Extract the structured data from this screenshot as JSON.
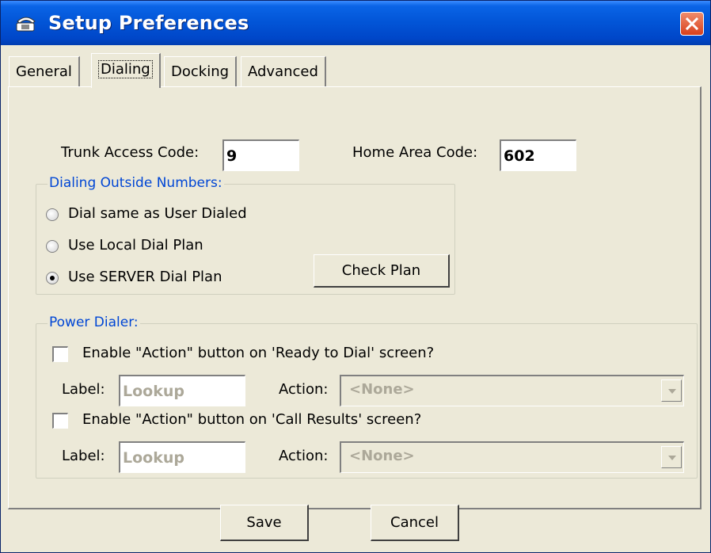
{
  "window": {
    "title": "Setup Preferences"
  },
  "tabs": [
    {
      "label": "General"
    },
    {
      "label": "Dialing",
      "selected": true
    },
    {
      "label": "Docking"
    },
    {
      "label": "Advanced"
    }
  ],
  "dialing": {
    "trunk_access_code": {
      "label": "Trunk Access Code:",
      "value": "9"
    },
    "home_area_code": {
      "label": "Home Area Code:",
      "value": "602"
    },
    "outside_numbers": {
      "title": "Dialing Outside Numbers:",
      "options": [
        {
          "label": "Dial same as User Dialed",
          "selected": false
        },
        {
          "label": "Use Local Dial Plan",
          "selected": false
        },
        {
          "label": "Use SERVER Dial Plan",
          "selected": true
        }
      ],
      "check_plan_label": "Check Plan"
    },
    "power_dialer": {
      "title": "Power Dialer:",
      "ready_to_dial": {
        "checkbox_label": "Enable \"Action\" button on 'Ready to Dial' screen?",
        "checked": false,
        "label_caption": "Label:",
        "label_value": "Lookup",
        "action_caption": "Action:",
        "action_value": "<None>"
      },
      "call_results": {
        "checkbox_label": "Enable \"Action\" button on 'Call Results' screen?",
        "checked": false,
        "label_caption": "Label:",
        "label_value": "Lookup",
        "action_caption": "Action:",
        "action_value": "<None>"
      }
    }
  },
  "footer": {
    "save_label": "Save",
    "cancel_label": "Cancel"
  },
  "colors": {
    "titlebar": "#0254d6",
    "face": "#ece9d8",
    "group_title": "#0046d5",
    "close": "#d8401c"
  },
  "icons": {
    "app": "phone-icon",
    "close": "close-icon",
    "dropdown": "chevron-down-icon"
  }
}
